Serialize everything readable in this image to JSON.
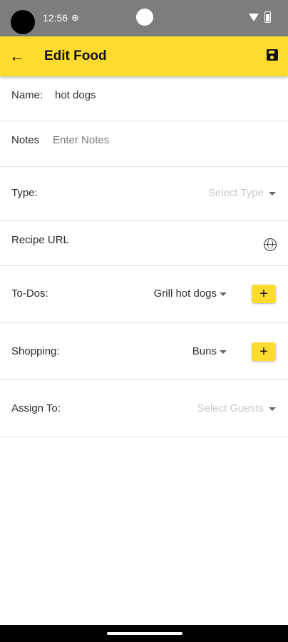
{
  "status_bar": {
    "time": "12:56",
    "sync_icon": "sync-icon",
    "wifi_icon": "wifi-icon",
    "battery_icon": "battery-icon"
  },
  "app_bar": {
    "title": "Edit Food",
    "back_icon": "back-arrow-icon",
    "save_icon": "save-icon",
    "color": "#fddb2f"
  },
  "form": {
    "name": {
      "label": "Name:",
      "value": "hot dogs"
    },
    "notes": {
      "label": "Notes",
      "placeholder": "Enter Notes"
    },
    "type": {
      "label": "Type:",
      "placeholder": "Select Type"
    },
    "recipe_url": {
      "label": "Recipe URL",
      "icon": "globe-icon"
    },
    "todos": {
      "label": "To-Dos:",
      "selected": "Grill hot dogs",
      "add_label": "+"
    },
    "shopping": {
      "label": "Shopping:",
      "selected": "Buns",
      "add_label": "+"
    },
    "assign_to": {
      "label": "Assign To:",
      "placeholder": "Select Guests"
    }
  }
}
